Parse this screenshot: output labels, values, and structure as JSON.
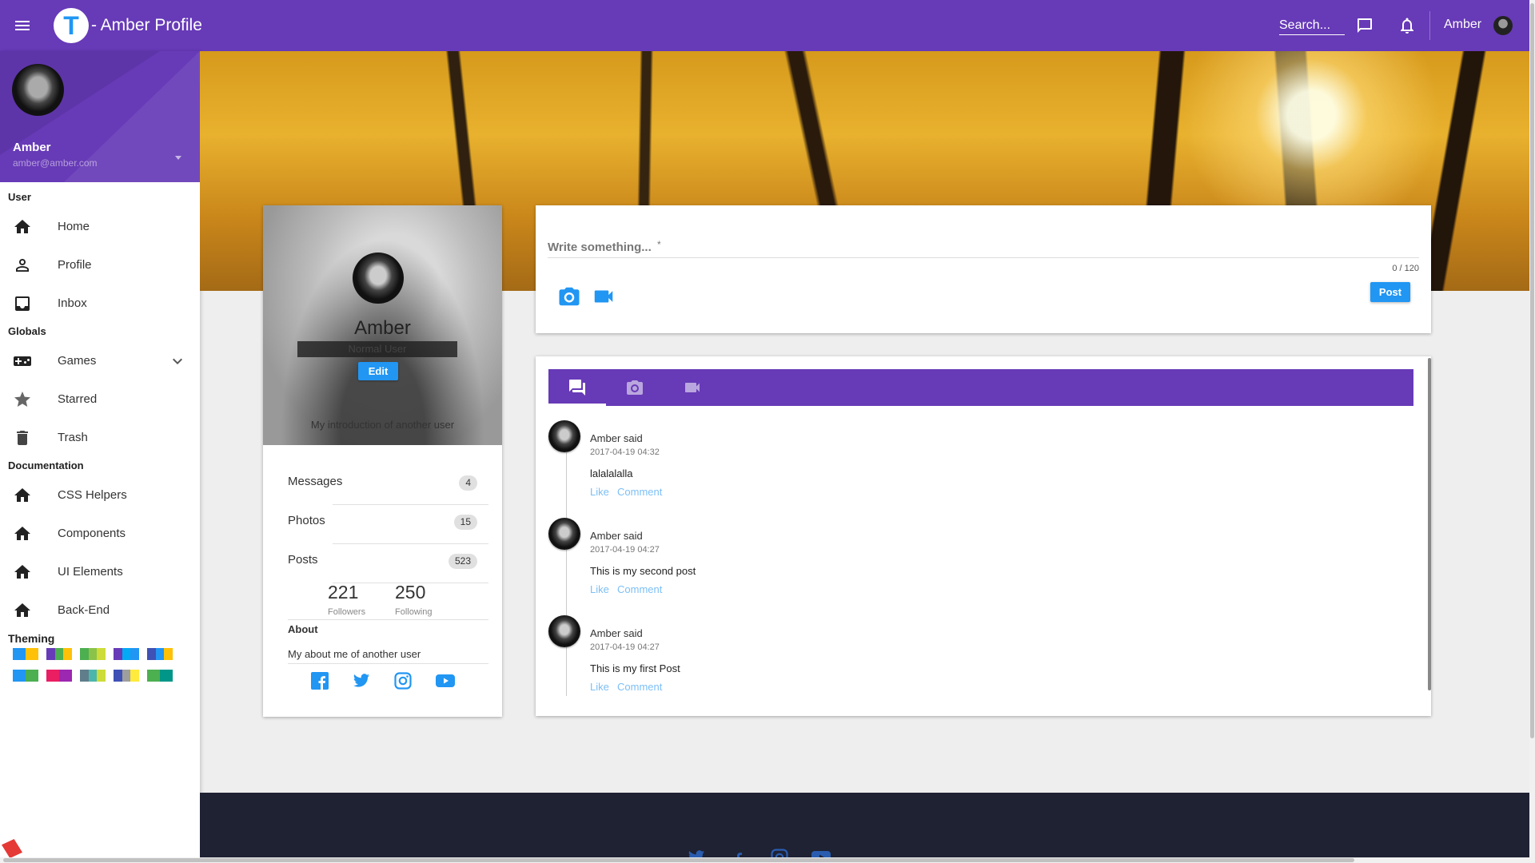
{
  "header": {
    "logo_letter": "T",
    "title": "- Amber Profile",
    "search_placeholder": "Search...",
    "username": "Amber"
  },
  "sidebar": {
    "user_name": "Amber",
    "user_email": "amber@amber.com",
    "sections": {
      "user": "User",
      "globals": "Globals",
      "documentation": "Documentation",
      "theming": "Theming"
    },
    "items": [
      {
        "label": "Home",
        "icon": "home-icon"
      },
      {
        "label": "Profile",
        "icon": "person-icon"
      },
      {
        "label": "Inbox",
        "icon": "inbox-icon"
      },
      {
        "label": "Games",
        "icon": "gamepad-icon"
      },
      {
        "label": "Starred",
        "icon": "star-icon"
      },
      {
        "label": "Trash",
        "icon": "trash-icon"
      },
      {
        "label": "CSS Helpers",
        "icon": "home-icon"
      },
      {
        "label": "Components",
        "icon": "home-icon"
      },
      {
        "label": "UI Elements",
        "icon": "home-icon"
      },
      {
        "label": "Back-End",
        "icon": "home-icon"
      }
    ],
    "theme_swatches": [
      [
        "#2196f3",
        "#ffc107"
      ],
      [
        "#673ab7",
        "#4caf50",
        "#ffc107"
      ],
      [
        "#4caf50",
        "#8bc34a",
        "#cddc39"
      ],
      [
        "#673ab7",
        "#03a9f4",
        "#2196f3"
      ],
      [
        "#3f51b5",
        "#2196f3",
        "#ffc107"
      ],
      [
        "#2196f3",
        "#4caf50"
      ],
      [
        "#e91e63",
        "#9c27b0"
      ],
      [
        "#607d8b",
        "#4db6ac",
        "#cddc39"
      ],
      [
        "#3f51b5",
        "#9e9e9e",
        "#ffeb3b"
      ],
      [
        "#4caf50",
        "#009688"
      ]
    ]
  },
  "profile": {
    "name": "Amber",
    "role": "Normal User",
    "edit_label": "Edit",
    "intro": "My introduction of another user",
    "stats": [
      {
        "label": "Messages",
        "count": "4"
      },
      {
        "label": "Photos",
        "count": "15"
      },
      {
        "label": "Posts",
        "count": "523"
      }
    ],
    "followers": "221",
    "followers_label": "Followers",
    "following": "250",
    "following_label": "Following",
    "about_heading": "About",
    "about_text": "My about me of another user",
    "social_icons": [
      "facebook-icon",
      "twitter-icon",
      "instagram-icon",
      "youtube-icon"
    ]
  },
  "composer": {
    "placeholder": "Write something...",
    "required_mark": "*",
    "counter": "0 / 120",
    "post_label": "Post"
  },
  "feed": {
    "tabs": [
      "chat-icon",
      "camera-icon",
      "video-icon"
    ],
    "posts": [
      {
        "author": "Amber said",
        "time": "2017-04-19 04:32",
        "text": "lalalalalla",
        "like": "Like",
        "comment": "Comment"
      },
      {
        "author": "Amber said",
        "time": "2017-04-19 04:27",
        "text": "This is my second post",
        "like": "Like",
        "comment": "Comment"
      },
      {
        "author": "Amber said",
        "time": "2017-04-19 04:27",
        "text": "This is my first Post",
        "like": "Like",
        "comment": "Comment"
      }
    ]
  },
  "colors": {
    "primary": "#673ab7",
    "accent": "#2196f3",
    "footer": "#1f2233"
  }
}
